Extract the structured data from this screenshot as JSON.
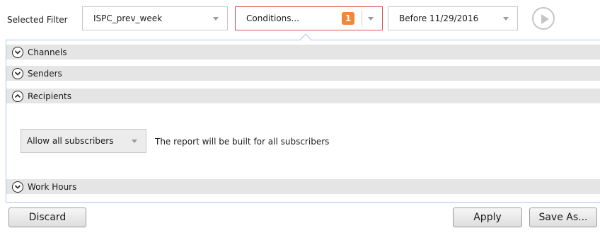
{
  "filter_bar": {
    "label": "Selected Filter",
    "filter_value": "ISPC_prev_week",
    "conditions_label": "Conditions...",
    "conditions_count": "1",
    "date_value": "Before 11/29/2016"
  },
  "sections": [
    {
      "label": "Channels",
      "expanded": false
    },
    {
      "label": "Senders",
      "expanded": false
    },
    {
      "label": "Recipients",
      "expanded": true
    },
    {
      "label": "Work Hours",
      "expanded": false
    }
  ],
  "recipients": {
    "mode_value": "Allow all subscribers",
    "description": "The report will be built for all subscribers"
  },
  "buttons": {
    "discard": "Discard",
    "apply": "Apply",
    "save_as": "Save As..."
  },
  "colors": {
    "accent_border": "#d9534f",
    "badge": "#f0883a",
    "panel_border": "#a9c7e8",
    "section_header": "#e5e5e5"
  }
}
